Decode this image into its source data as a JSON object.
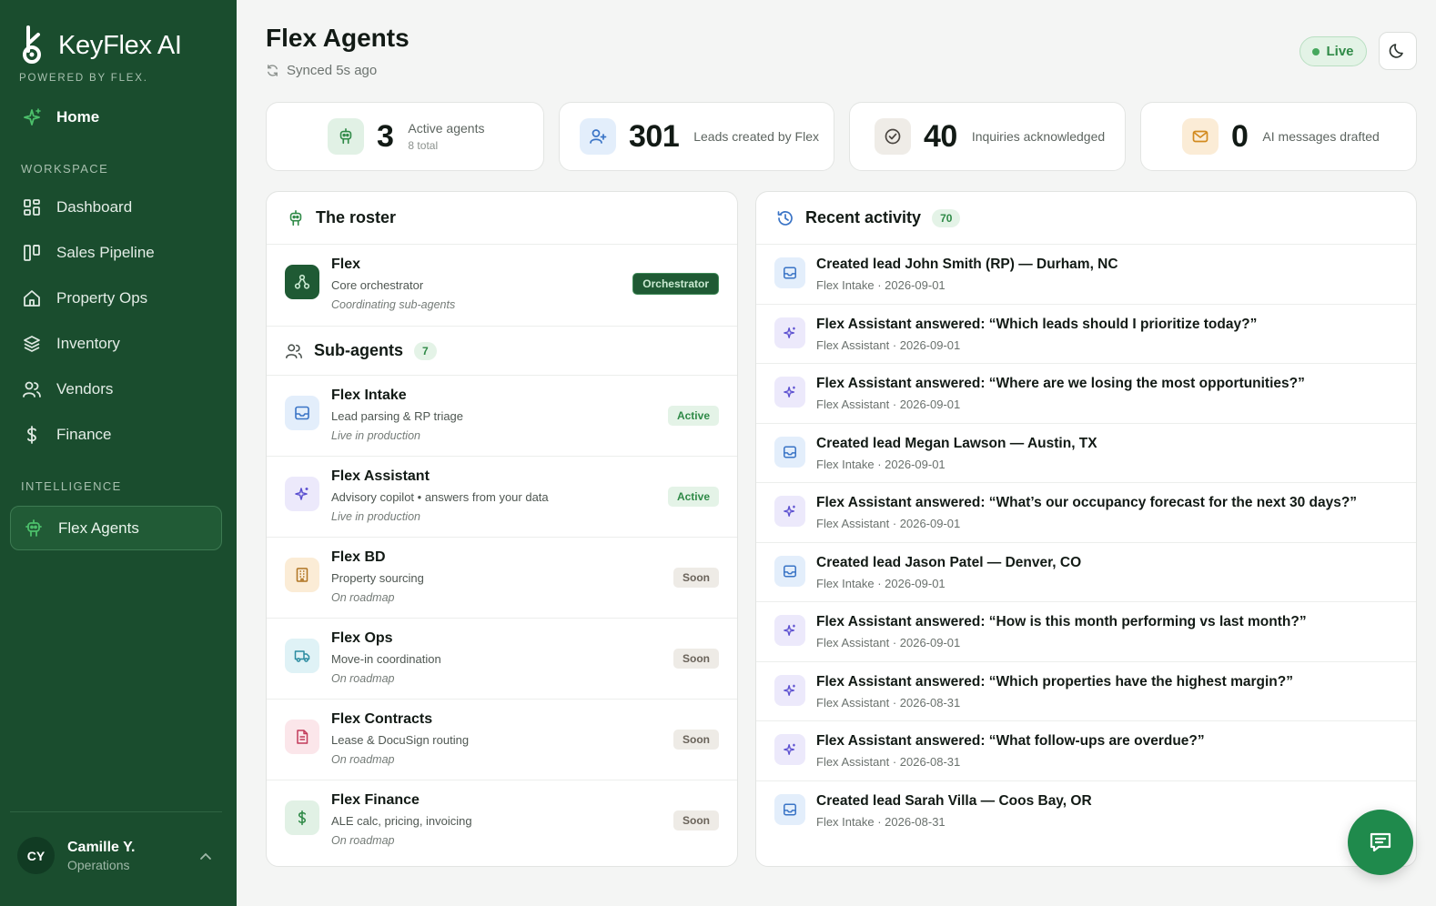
{
  "brand": {
    "name": "KeyFlex AI",
    "tagline": "POWERED BY FLEX."
  },
  "sidebar": {
    "home": "Home",
    "workspace_label": "WORKSPACE",
    "workspace_items": [
      "Dashboard",
      "Sales Pipeline",
      "Property Ops",
      "Inventory",
      "Vendors",
      "Finance"
    ],
    "intelligence_label": "INTELLIGENCE",
    "active_item": "Flex Agents",
    "user": {
      "initials": "CY",
      "name": "Camille Y.",
      "role": "Operations"
    }
  },
  "header": {
    "title": "Flex Agents",
    "synced": "Synced 5s ago",
    "live_label": "Live"
  },
  "stats": [
    {
      "value": "3",
      "label": "Active agents",
      "sub": "8 total"
    },
    {
      "value": "301",
      "label": "Leads created by Flex"
    },
    {
      "value": "40",
      "label": "Inquiries acknowledged"
    },
    {
      "value": "0",
      "label": "AI messages drafted"
    }
  ],
  "roster": {
    "title": "The roster",
    "orchestrator": {
      "name": "Flex",
      "desc": "Core orchestrator",
      "status": "Coordinating sub-agents",
      "badge": "Orchestrator"
    },
    "sub_title": "Sub-agents",
    "sub_count": "7",
    "agents": [
      {
        "name": "Flex Intake",
        "desc": "Lead parsing & RP triage",
        "status": "Live in production",
        "badge": "Active"
      },
      {
        "name": "Flex Assistant",
        "desc": "Advisory copilot • answers from your data",
        "status": "Live in production",
        "badge": "Active"
      },
      {
        "name": "Flex BD",
        "desc": "Property sourcing",
        "status": "On roadmap",
        "badge": "Soon"
      },
      {
        "name": "Flex Ops",
        "desc": "Move-in coordination",
        "status": "On roadmap",
        "badge": "Soon"
      },
      {
        "name": "Flex Contracts",
        "desc": "Lease & DocuSign routing",
        "status": "On roadmap",
        "badge": "Soon"
      },
      {
        "name": "Flex Finance",
        "desc": "ALE calc, pricing, invoicing",
        "status": "On roadmap",
        "badge": "Soon"
      }
    ]
  },
  "activity": {
    "title": "Recent activity",
    "count": "70",
    "items": [
      {
        "title": "Created lead John Smith (RP) — Durham, NC",
        "source": "Flex Intake",
        "date": "2026-09-01"
      },
      {
        "title": "Flex Assistant answered: “Which leads should I prioritize today?”",
        "source": "Flex Assistant",
        "date": "2026-09-01"
      },
      {
        "title": "Flex Assistant answered: “Where are we losing the most opportunities?”",
        "source": "Flex Assistant",
        "date": "2026-09-01"
      },
      {
        "title": "Created lead Megan Lawson — Austin, TX",
        "source": "Flex Intake",
        "date": "2026-09-01"
      },
      {
        "title": "Flex Assistant answered: “What’s our occupancy forecast for the next 30 days?”",
        "source": "Flex Assistant",
        "date": "2026-09-01"
      },
      {
        "title": "Created lead Jason Patel — Denver, CO",
        "source": "Flex Intake",
        "date": "2026-09-01"
      },
      {
        "title": "Flex Assistant answered: “How is this month performing vs last month?”",
        "source": "Flex Assistant",
        "date": "2026-09-01"
      },
      {
        "title": "Flex Assistant answered: “Which properties have the highest margin?”",
        "source": "Flex Assistant",
        "date": "2026-08-31"
      },
      {
        "title": "Flex Assistant answered: “What follow-ups are overdue?”",
        "source": "Flex Assistant",
        "date": "2026-08-31"
      },
      {
        "title": "Created lead Sarah Villa — Coos Bay, OR",
        "source": "Flex Intake",
        "date": "2026-08-31"
      }
    ],
    "separator": " · "
  },
  "colors": {
    "sidebar": "#1a4d2e",
    "accent": "#2f8a47",
    "fab": "#1f8a4c"
  }
}
